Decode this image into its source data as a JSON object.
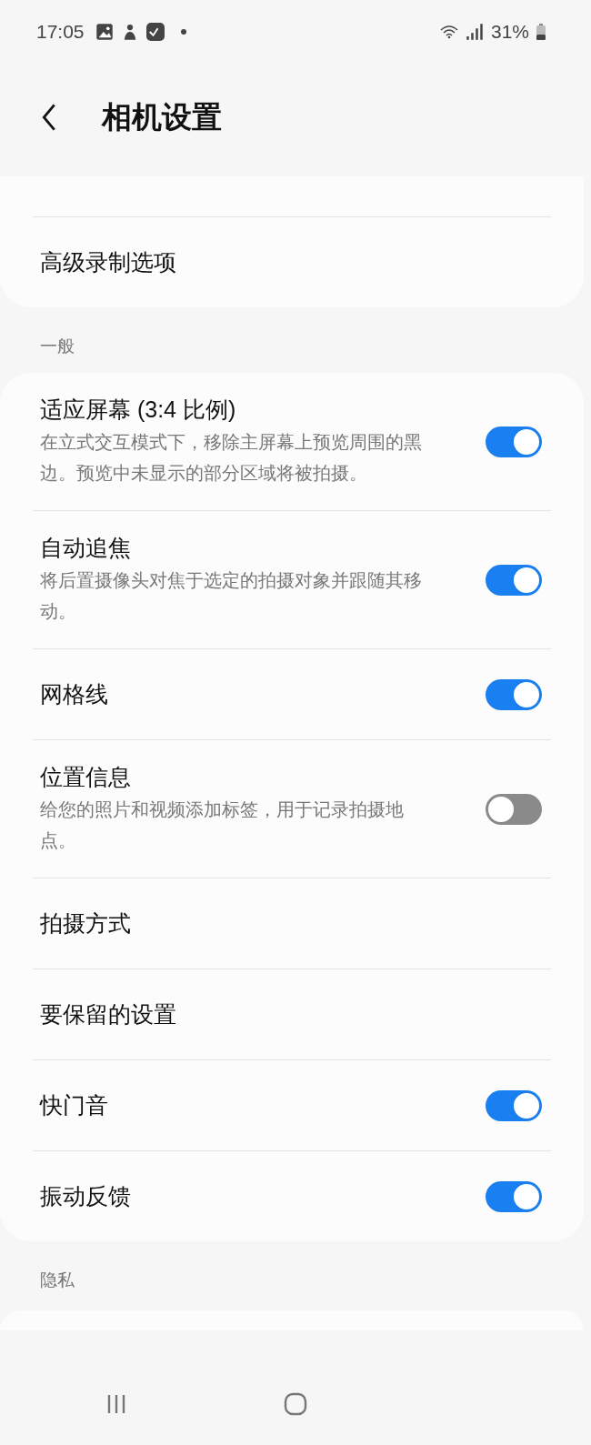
{
  "status_bar": {
    "time": "17:05",
    "battery": "31%"
  },
  "header": {
    "title": "相机设置"
  },
  "sections": [
    {
      "items": [
        {
          "title": "高级录制选项"
        }
      ]
    },
    {
      "label": "一般",
      "items": [
        {
          "title": "适应屏幕 (3:4 比例)",
          "description": "在立式交互模式下，移除主屏幕上预览周围的黑边。预览中未显示的部分区域将被拍摄。",
          "kind": "toggle",
          "on": true
        },
        {
          "title": "自动追焦",
          "description": "将后置摄像头对焦于选定的拍摄对象并跟随其移动。",
          "kind": "toggle",
          "on": true
        },
        {
          "title": "网格线",
          "kind": "toggle",
          "on": true
        },
        {
          "title": "位置信息",
          "description": "给您的照片和视频添加标签，用于记录拍摄地点。",
          "kind": "toggle",
          "on": false
        },
        {
          "title": "拍摄方式"
        },
        {
          "title": "要保留的设置"
        },
        {
          "title": "快门音",
          "kind": "toggle",
          "on": true
        },
        {
          "title": "振动反馈",
          "kind": "toggle",
          "on": true
        }
      ]
    },
    {
      "label": "隐私"
    }
  ]
}
